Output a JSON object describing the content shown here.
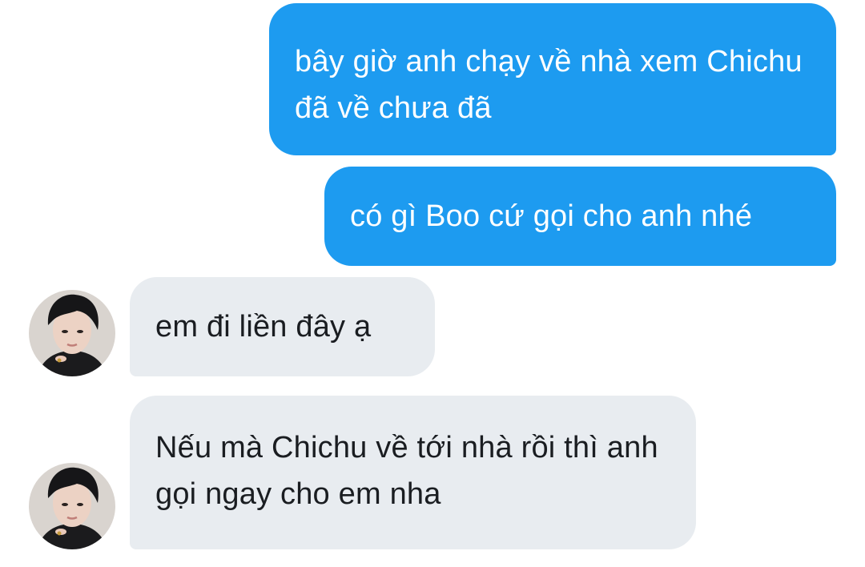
{
  "messages": [
    {
      "id": "m1",
      "direction": "outgoing",
      "text": "bây giờ anh chạy về nhà xem Chichu đã về chưa đã"
    },
    {
      "id": "m2",
      "direction": "outgoing",
      "text": "có gì Boo cứ gọi cho anh nhé"
    },
    {
      "id": "m3",
      "direction": "incoming",
      "text": "em đi liền đây ạ"
    },
    {
      "id": "m4",
      "direction": "incoming",
      "text": "Nếu mà Chichu về tới nhà rồi thì anh gọi ngay cho em nha"
    }
  ],
  "colors": {
    "outgoing_bubble": "#1d9bf0",
    "incoming_bubble": "#e8ecf0",
    "outgoing_text": "#ffffff",
    "incoming_text": "#1a1d21"
  },
  "icons": {
    "avatar": "contact-avatar-photo"
  }
}
